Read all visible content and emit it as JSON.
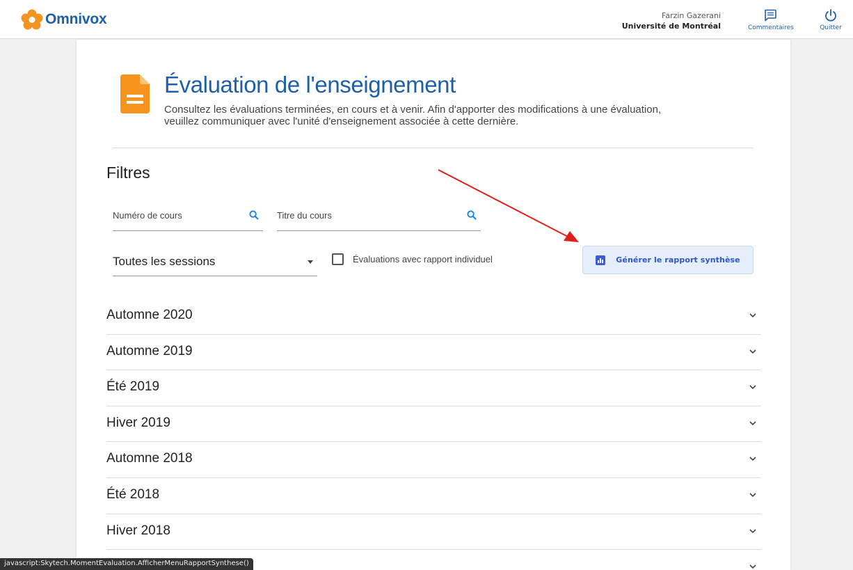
{
  "header": {
    "brand": "Omnivox",
    "user_name": "Farzin Gazerani",
    "user_org": "Université de Montréal",
    "comments_label": "Commentaires",
    "quit_label": "Quitter"
  },
  "page": {
    "title": "Évaluation de l'enseignement",
    "description": "Consultez les évaluations terminées, en cours et à venir. Afin d'apporter des modifications à une évaluation, veuillez communiquer avec l'unité d'enseignement associée à cette dernière."
  },
  "filters": {
    "title": "Filtres",
    "course_number_label": "Numéro de cours",
    "course_title_label": "Titre du cours",
    "session_select_value": "Toutes les sessions",
    "individual_report_label": "Évaluations avec rapport individuel",
    "individual_report_checked": false,
    "generate_button_label": "Générer le rapport synthèse"
  },
  "sessions": [
    {
      "label": "Automne 2020"
    },
    {
      "label": "Automne 2019"
    },
    {
      "label": "Été 2019"
    },
    {
      "label": "Hiver 2019"
    },
    {
      "label": "Automne 2018"
    },
    {
      "label": "Été 2018"
    },
    {
      "label": "Hiver 2018"
    },
    {
      "label": ""
    }
  ],
  "status_bar": "javascript:Skytech.MomentEvaluation.AfficherMenuRapportSynthese()",
  "colors": {
    "brand_blue": "#1f5fa7",
    "logo_orange": "#f29423",
    "page_icon_orange": "#f7941d",
    "search_icon_blue": "#1e88e5",
    "button_bg": "#e4effb",
    "button_text": "#2f54c9",
    "annotation_arrow": "#e0201b"
  },
  "icons": {
    "logo": "flower-icon",
    "comments": "chat-icon",
    "quit": "power-icon",
    "page": "document-icon",
    "search": "search-icon",
    "generate": "bar-chart-icon",
    "expand": "chevron-down-icon"
  }
}
